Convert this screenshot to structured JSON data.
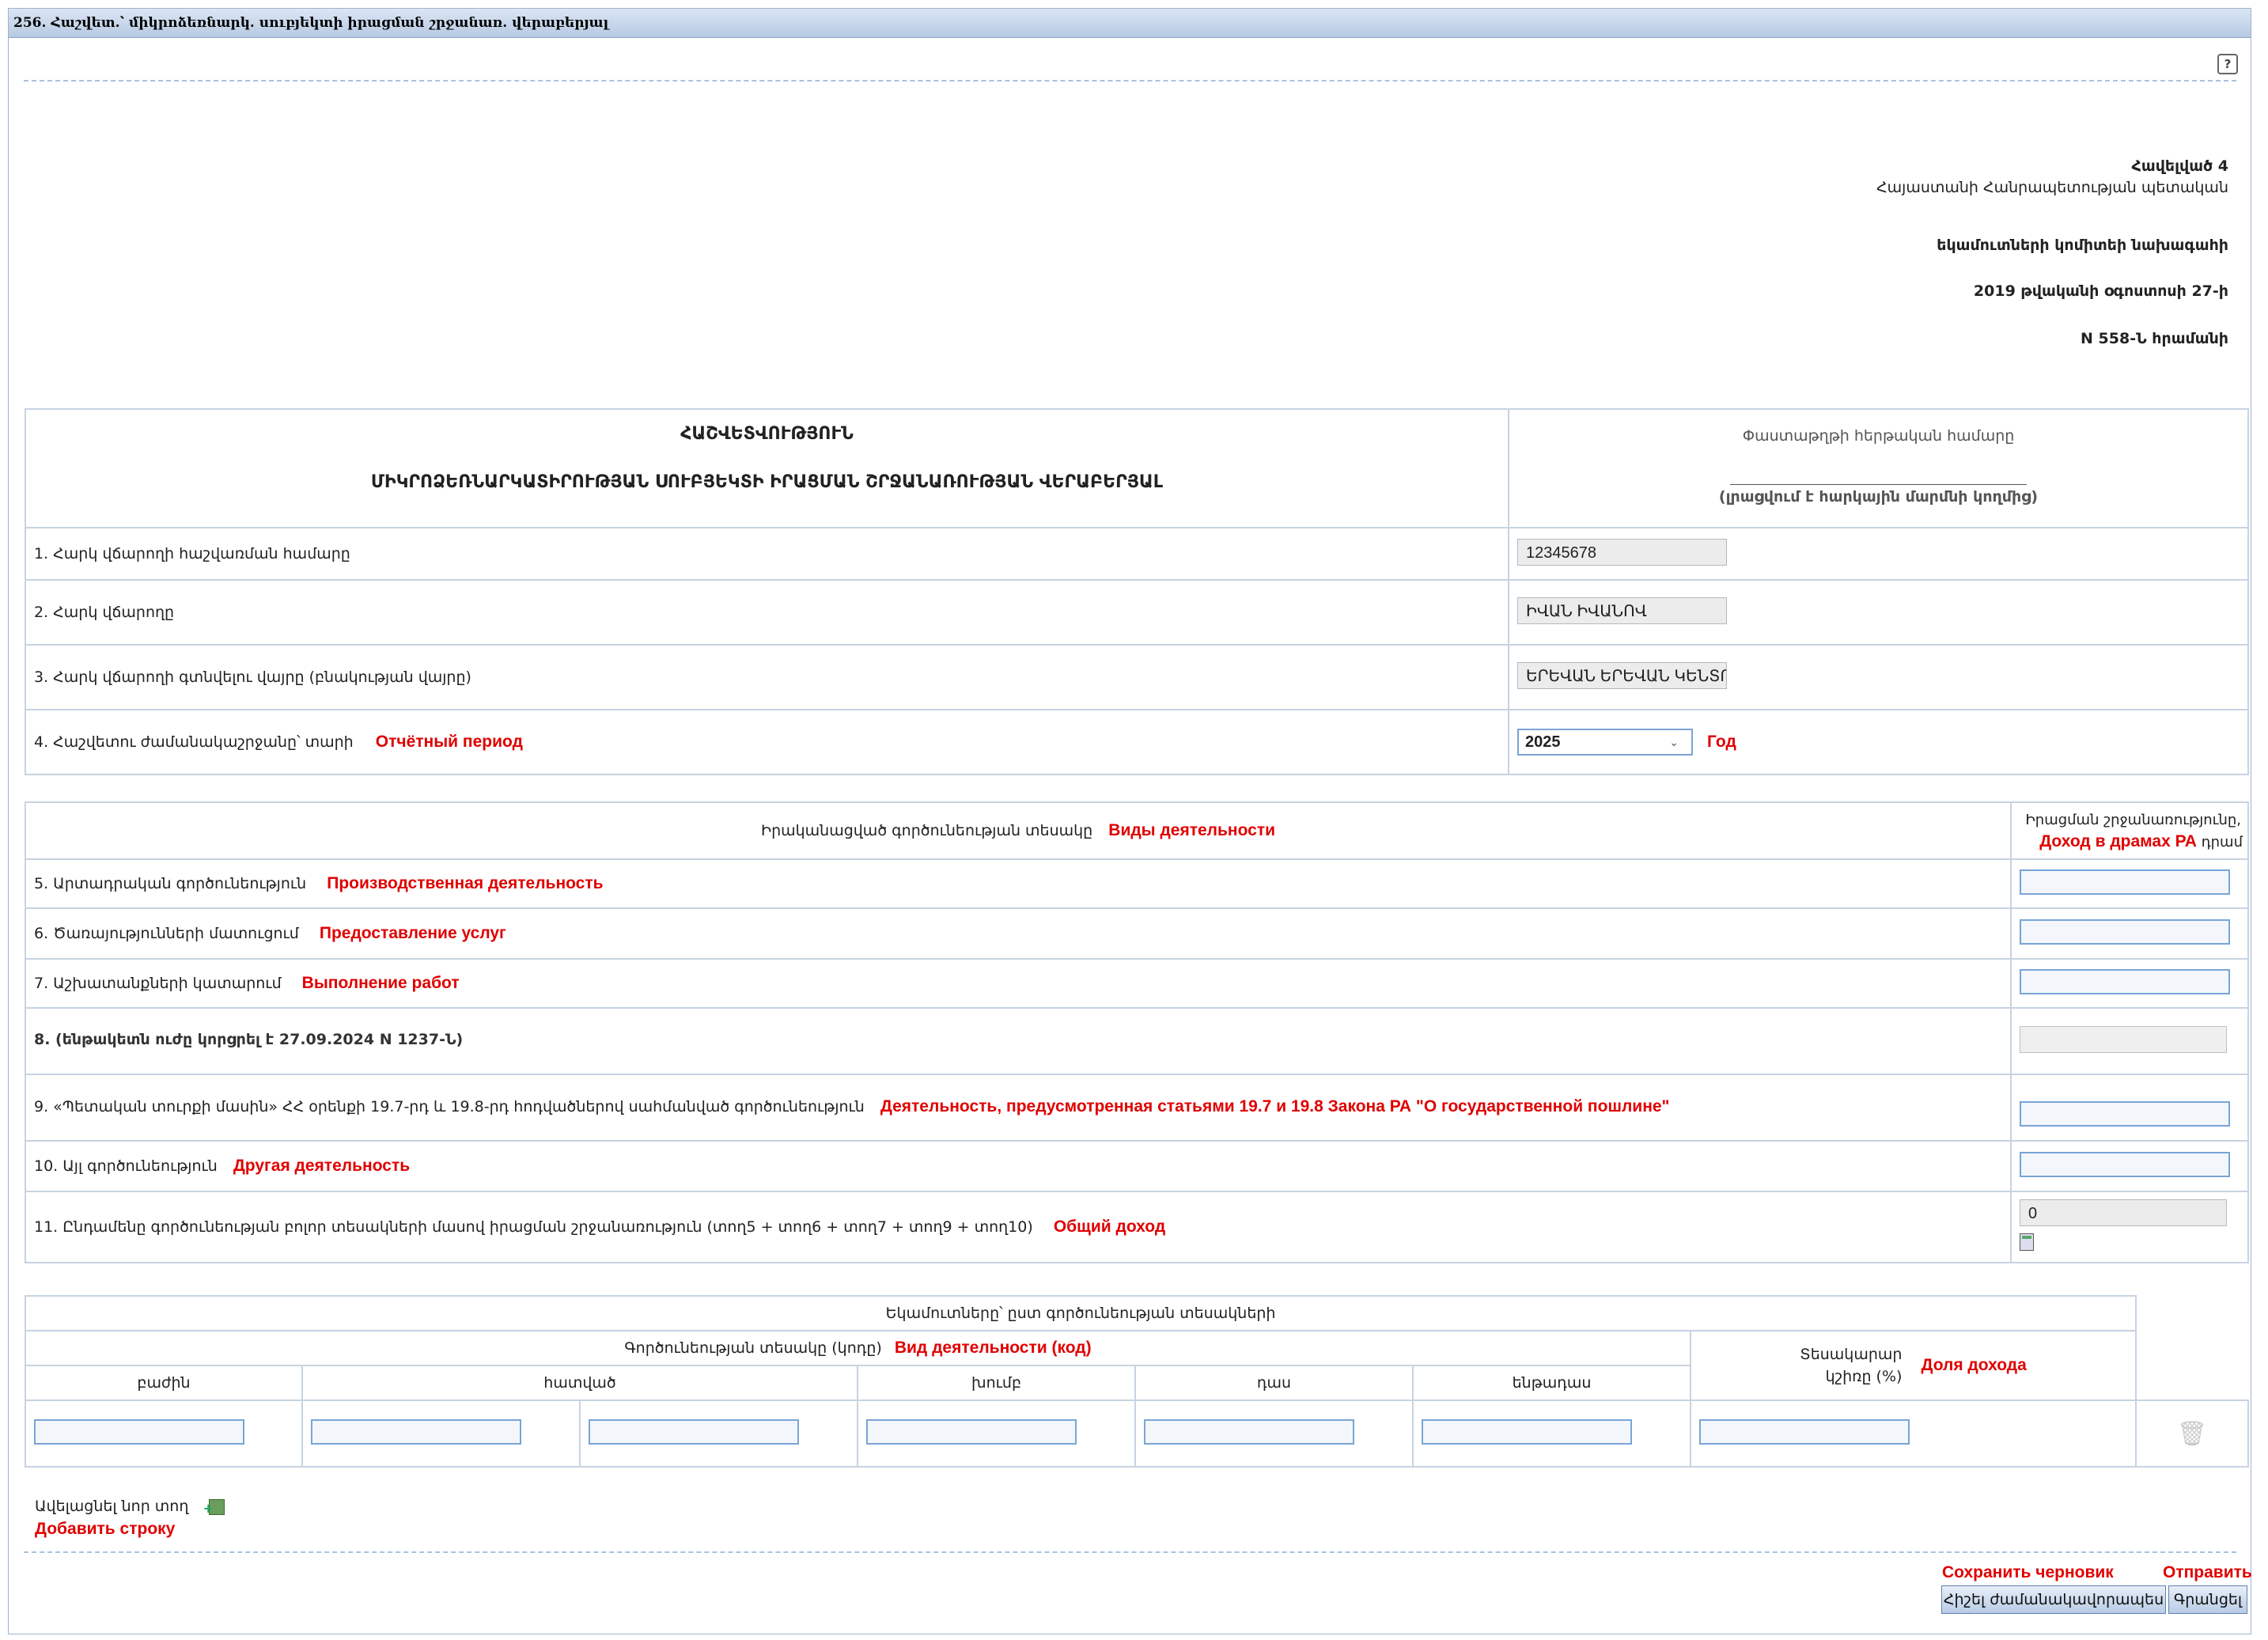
{
  "window": {
    "title": "256. Հաշվետ.՝ միկրոձեռնարկ. սուբյեկտի իրացման շրջանառ. վերաբերյալ"
  },
  "approval": {
    "line1": "Հավելված 4",
    "line2": "Հայաստանի Հանրապետության պետական",
    "line3": "եկամուտների կոմիտեի նախագահի",
    "line4": "2019 թվականի օգոստոսի 27-ի",
    "line5": "N 558-Ն հրամանի"
  },
  "report": {
    "heading1": "ՀԱՇՎԵՏՎՈՒԹՅՈՒՆ",
    "heading2": "ՄԻԿՐՈՁԵՌՆԱՐԿԱՏԻՐՈՒԹՅԱՆ ՍՈՒԲՅԵԿՏԻ ԻՐԱՑՄԱՆ ՇՐՋԱՆԱՌՈՒԹՅԱՆ ՎԵՐԱԲԵՐՅԱԼ",
    "doc_number_label": "Փաստաթղթի հերթական համարը",
    "doc_number_note": "(լրացվում է հարկային մարմնի կողմից)"
  },
  "taxpayer": {
    "r1_label": "1. Հարկ վճարողի հաշվառման համարը",
    "r1_value": "12345678",
    "r2_label": "2. Հարկ վճարողը",
    "r2_value": "ԻՎԱՆ ԻՎԱՆՈՎ",
    "r3_label": "3. Հարկ վճարողի գտնվելու վայրը (բնակության վայրը)",
    "r3_value": "ԵՐԵՎԱՆ ԵՐԵՎԱՆ ԿԵՆՏՐՈՆ",
    "r4_label": "4. Հաշվետու ժամանակաշրջանը՝ տարի",
    "r4_note": "Отчётный период",
    "year_value": "2025",
    "year_note": "Год"
  },
  "activities": {
    "header_label": "Իրականացված գործունեության տեսակը",
    "header_note": "Виды деятельности",
    "turnover_header_1": "Իրացման շրջանառությունը,",
    "turnover_header_note": "Доход в драмах РА",
    "turnover_header_2": "դրամ",
    "rows": [
      {
        "label": "5. Արտադրական գործունեություն",
        "note": "Производственная деятельность"
      },
      {
        "label": "6. Ծառայությունների մատուցում",
        "note": "Предоставление услуг"
      },
      {
        "label": "7. Աշխատանքների կատարում",
        "note": "Выполнение работ"
      },
      {
        "label": "8. (ենթակետն ուժը կորցրել է 27.09.2024 N 1237-Ն)",
        "note": ""
      },
      {
        "label": "9. «Պետական տուրքի մասին» ՀՀ օրենքի 19.7-րդ և 19.8-րդ հոդվածներով սահմանված գործունեություն",
        "note": "Деятельность, предусмотренная статьями 19.7 и 19.8 Закона РА \"О государственной пошлине\""
      },
      {
        "label": "10. Այլ գործունեություն",
        "note": "Другая деятельность"
      },
      {
        "label": "11. Ընդամենը գործունեության բոլոր տեսակների մասով իրացման շրջանառություն (տող5 + տող6 + տող7 + տող9 + տող10)",
        "note": "Общий доход"
      }
    ],
    "total_value": "0"
  },
  "incomes": {
    "title": "Եկամուտները՝ ըստ գործունեության տեսակների",
    "activity_code_label": "Գործունեության տեսակը (կոդը)",
    "activity_code_note": "Вид деятельности (код)",
    "share_label_1": "Տեսակարար",
    "share_label_2": "կշիռը (%)",
    "share_note": "Доля дохода",
    "cols": [
      "բաժին",
      "հատված",
      "խումբ",
      "դաս",
      "ենթադաս"
    ]
  },
  "add_row": {
    "label": "Ավելացնել նոր տող",
    "note": "Добавить строку"
  },
  "buttons": {
    "save_label": "Հիշել ժամանակավորապես",
    "save_note": "Сохранить черновик",
    "submit_label": "Գրանցել",
    "submit_note": "Отправить"
  },
  "colors": {
    "annotation": "#e00000",
    "border": "#c7d3e2",
    "input_border": "#7aa4d6"
  }
}
